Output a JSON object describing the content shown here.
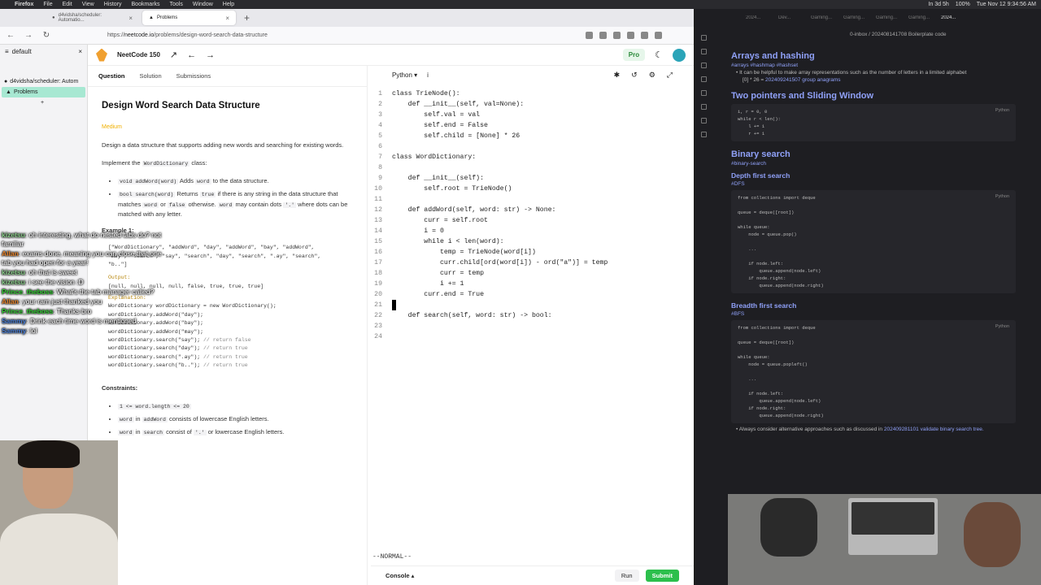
{
  "menubar": {
    "app": "Firefox",
    "items": [
      "File",
      "Edit",
      "View",
      "History",
      "Bookmarks",
      "Tools",
      "Window",
      "Help"
    ],
    "status": [
      "In 3d 5h",
      "100%",
      "Tue Nov 12  9:34:56 AM"
    ]
  },
  "firefox": {
    "tabs": [
      {
        "label": "d4vidsha/scheduler: Automatio..."
      },
      {
        "label": "Problems"
      }
    ],
    "url_prefix": "https://",
    "url_host": "neetcode.io",
    "url_path": "/problems/design-word-search-data-structure",
    "sidebar": {
      "workspace": "default",
      "items": [
        "d4vidsha/scheduler: Autom",
        "Problems"
      ]
    }
  },
  "leetcode": {
    "brand": "NeetCode 150",
    "pro": "Pro",
    "tabs": [
      "Question",
      "Solution",
      "Submissions"
    ],
    "title": "Design Word Search Data Structure",
    "difficulty": "Medium",
    "desc": "Design a data structure that supports adding new words and searching for existing words.",
    "implement": "Implement the",
    "impl_code": "WordDictionary",
    "impl_tail": "class:",
    "m1_code": "void addWord(word)",
    "m1_text": "Adds",
    "m1_code2": "word",
    "m1_tail": "to the data structure.",
    "m2_code": "bool search(word)",
    "m2_text": "Returns",
    "m2_code2": "true",
    "m2_mid": "if there is any string in the data structure that matches",
    "m2_code3": "word",
    "m2_or": "or",
    "m2_code4": "false",
    "m2_mid2": "otherwise.",
    "m2_code5": "word",
    "m2_mid3": "may contain dots",
    "m2_code6": "'.'",
    "m2_tail": "where dots can be matched with any letter.",
    "example_label": "Example 1:",
    "input_line1": "[\"WordDictionary\", \"addWord\", \"day\", \"addWord\", \"bay\", \"addWord\",",
    "input_line2": "\"may\", \"search\", \"say\", \"search\", \"day\", \"search\", \".ay\", \"search\",",
    "input_line3": "\"b..\"]",
    "output_label": "Output:",
    "output_value": "[null, null, null, null, false, true, true, true]",
    "explanation_label": "Explanation:",
    "ex1": "WordDictionary wordDictionary = new WordDictionary();",
    "ex2": "wordDictionary.addWord(\"day\");",
    "ex3": "wordDictionary.addWord(\"bay\");",
    "ex4": "wordDictionary.addWord(\"may\");",
    "ex5a": "wordDictionary.search(\"say\");",
    "ex5b": "// return false",
    "ex6a": "wordDictionary.search(\"day\");",
    "ex6b": "// return true",
    "ex7a": "wordDictionary.search(\".ay\");",
    "ex7b": "// return true",
    "ex8a": "wordDictionary.search(\"b..\");",
    "ex8b": "// return true",
    "constraints_label": "Constraints:",
    "c1": "1 <= word.length <= 20",
    "c2_code": "word",
    "c2_mid": "in",
    "c2_code2": "addWord",
    "c2_tail": "consists of lowercase English letters.",
    "c3_code": "word",
    "c3_mid": "in",
    "c3_code2": "search",
    "c3_mid2": "consist of",
    "c3_code3": "'.'",
    "c3_tail": "or lowercase English letters."
  },
  "editor": {
    "language": "Python",
    "mode": "--NORMAL--",
    "console": "Console",
    "run": "Run",
    "submit": "Submit",
    "lines": [
      "class TrieNode():",
      "    def __init__(self, val=None):",
      "        self.val = val",
      "        self.end = False",
      "        self.child = [None] * 26",
      "",
      "class WordDictionary:",
      "",
      "    def __init__(self):",
      "        self.root = TrieNode()",
      "",
      "    def addWord(self, word: str) -> None:",
      "        curr = self.root",
      "        i = 0",
      "        while i < len(word):",
      "            temp = TrieNode(word[i])",
      "            curr.child[ord(word[i]) - ord(\"a\")] = temp",
      "            curr = temp",
      "            i += 1",
      "        curr.end = True",
      " ",
      "    def search(self, word: str) -> bool:",
      "",
      ""
    ]
  },
  "chat": [
    {
      "user": "kizetsu",
      "msg": ": oh interesting, what do nested tabs do? not familiar",
      "cls": "u1"
    },
    {
      "user": "Allan",
      "msg": ": exams done, meaning you can close that one tab you had open for a year!",
      "cls": "u2"
    },
    {
      "user": "kizetsu",
      "msg": ": oh that is sweet",
      "cls": "u1"
    },
    {
      "user": "kizetsu",
      "msg": ": i see the vision :D",
      "cls": "u1"
    },
    {
      "user": "Prince_theboss",
      "msg": ": What's the tab manager called?",
      "cls": "u3"
    },
    {
      "user": "Allan",
      "msg": ": your ram just thanked you",
      "cls": "u2"
    },
    {
      "user": "Prince_theboss",
      "msg": ": Thanks bro",
      "cls": "u3"
    },
    {
      "user": "Sammy",
      "msg": ": Drink each time word is mentioned",
      "cls": "u4"
    },
    {
      "user": "Sammy",
      "msg": ": lol",
      "cls": "u4"
    }
  ],
  "obsidian": {
    "path": "0-inbox / 20240814170​8 Boilerplate code",
    "h_arrays": "Arrays and hashing",
    "t_arrays": "#arrays #hashmap #hashset",
    "b_arrays1": "It can be helpful to make array representations such as the number of letters in a limited alphabet",
    "b_arrays2_code": "[0] * 26",
    "b_arrays2_link": "202409241507 group anagrams",
    "h_two": "Two pointers and Sliding Window",
    "code_two": [
      "i, r = 0, 0",
      "while r < len():",
      "    l += 1",
      "    r += 1"
    ],
    "h_bs": "Binary search",
    "t_bs": "#binary-search",
    "h_dfs": "Depth first search",
    "t_dfs": "#DFS",
    "code_dfs": [
      "from collections import deque",
      "",
      "queue = deque([root])",
      "",
      "while queue:",
      "    node = queue.pop()",
      "",
      "    ...",
      "",
      "    if node.left:",
      "        queue.append(node.left)",
      "    if node.right:",
      "        queue.append(node.right)"
    ],
    "h_bfs": "Breadth first search",
    "t_bfs": "#BFS",
    "code_bfs": [
      "from collections import deque",
      "",
      "queue = deque([root])",
      "",
      "while queue:",
      "    node = queue.popleft()",
      "",
      "    ...",
      "",
      "    if node.left:",
      "        queue.append(node.left)",
      "    if node.right:",
      "        queue.append(node.right)"
    ],
    "lang": "Python",
    "b_last": "Always consider alternative approaches such as discussed in",
    "b_last_link": "202409281101 validate binary search tree."
  }
}
